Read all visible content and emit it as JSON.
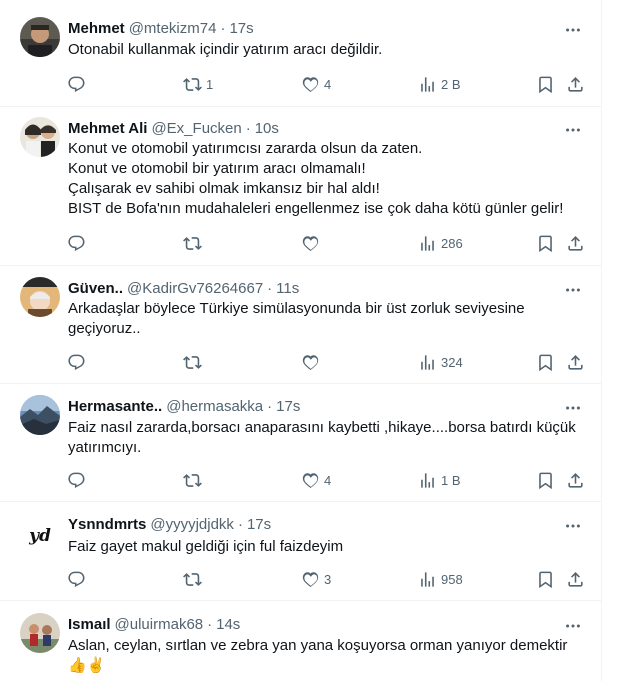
{
  "colors": {
    "text": "#0f1419",
    "muted": "#536471",
    "border": "#eff3f4"
  },
  "tweets": [
    {
      "name": "Mehmet",
      "handle": "@mtekizm74",
      "sep": "·",
      "time": "17s",
      "lines": [
        "Otonabil kullanmak içindir yatırım aracı değildir."
      ],
      "retweets": "1",
      "likes": "4",
      "views": "2 B"
    },
    {
      "name": "Mehmet Ali",
      "handle": "@Ex_Fucken",
      "sep": "·",
      "time": "10s",
      "lines": [
        "Konut ve otomobil yatırımcısı zararda olsun da zaten.",
        "Konut ve otomobil bir yatırım aracı olmamalı!",
        "Çalışarak ev sahibi olmak imkansız bir hal aldı!",
        "BIST de Bofa'nın mudahaleleri engellenmez ise çok daha kötü günler gelir!"
      ],
      "retweets": "",
      "likes": "",
      "views": "286"
    },
    {
      "name": "Güven..",
      "handle": "@KadirGv76264667",
      "sep": "·",
      "time": "11s",
      "lines": [
        "Arkadaşlar böylece Türkiye simülasyonunda bir üst zorluk seviyesine",
        "geçiyoruz.."
      ],
      "retweets": "",
      "likes": "",
      "views": "324"
    },
    {
      "name": "Hermasante..",
      "handle": "@hermasakka",
      "sep": "·",
      "time": "17s",
      "lines": [
        "Faiz nasıl zararda,borsacı anaparasını kaybetti ,hikaye....borsa batırdı küçük",
        "yatırımcıyı."
      ],
      "retweets": "",
      "likes": "4",
      "views": "1 B"
    },
    {
      "name": "Ysnndmrts",
      "handle": "@yyyyjdjdkk",
      "sep": "·",
      "time": "17s",
      "lines": [
        "Faiz gayet makul geldiği için ful faizdeyim"
      ],
      "retweets": "",
      "likes": "3",
      "views": "958"
    },
    {
      "name": "Ismaıl",
      "handle": "@uluirmak68",
      "sep": "·",
      "time": "14s",
      "lines": [
        "Aslan, ceylan, sırtlan ve zebra yan yana koşuyorsa orman yanıyor demektir",
        "👍✌️"
      ],
      "retweets": "",
      "likes": "",
      "views": ""
    }
  ],
  "avatar_logo_text": "yd"
}
